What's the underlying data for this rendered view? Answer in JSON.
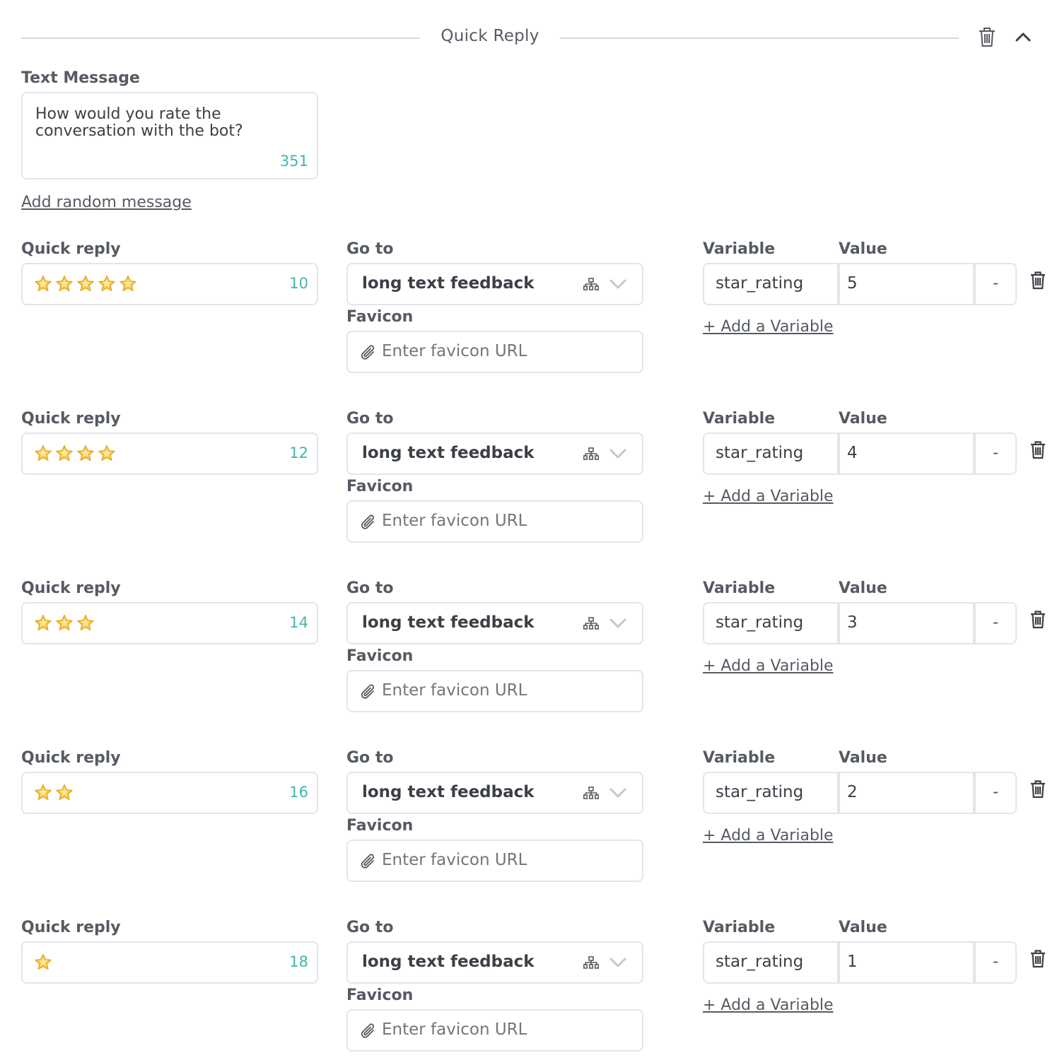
{
  "header": {
    "title": "Quick Reply"
  },
  "text_message": {
    "label": "Text Message",
    "value": "How would you rate the conversation with the bot?",
    "counter": "351"
  },
  "add_random_label": "Add random message",
  "labels": {
    "quick_reply": "Quick reply",
    "goto": "Go to",
    "favicon": "Favicon",
    "variable": "Variable",
    "value": "Value",
    "add_variable": "+ Add a Variable",
    "remove_value": "-",
    "favicon_placeholder": "Enter favicon URL"
  },
  "replies": [
    {
      "stars": 5,
      "counter": "10",
      "goto": "long text feedback",
      "variable": "star_rating",
      "value": "5"
    },
    {
      "stars": 4,
      "counter": "12",
      "goto": "long text feedback",
      "variable": "star_rating",
      "value": "4"
    },
    {
      "stars": 3,
      "counter": "14",
      "goto": "long text feedback",
      "variable": "star_rating",
      "value": "3"
    },
    {
      "stars": 2,
      "counter": "16",
      "goto": "long text feedback",
      "variable": "star_rating",
      "value": "2"
    },
    {
      "stars": 1,
      "counter": "18",
      "goto": "long text feedback",
      "variable": "star_rating",
      "value": "1"
    }
  ],
  "colors": {
    "counter": "#3fb5b0",
    "border": "#e3e5e9",
    "text": "#555a63",
    "star": "#f7c948"
  }
}
